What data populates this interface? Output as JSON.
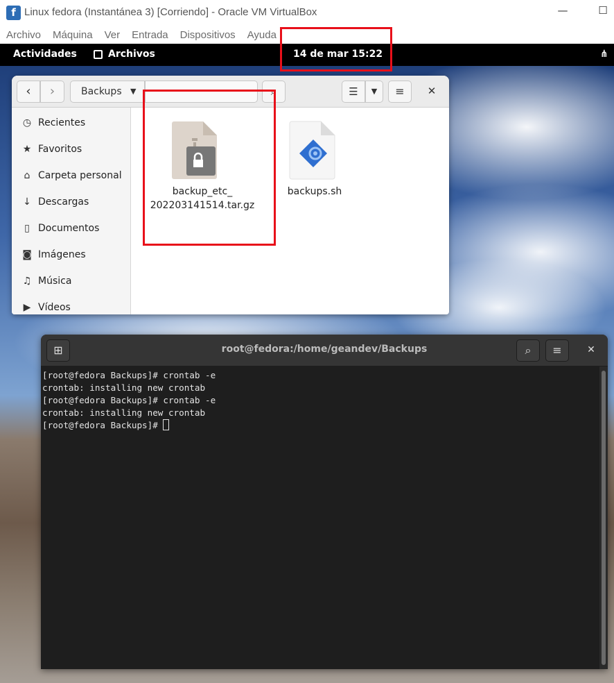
{
  "vbox": {
    "title": "Linux fedora (Instantánea 3) [Corriendo] - Oracle VM VirtualBox",
    "menu": [
      "Archivo",
      "Máquina",
      "Ver",
      "Entrada",
      "Dispositivos",
      "Ayuda"
    ]
  },
  "topbar": {
    "activities": "Actividades",
    "app_name": "Archivos",
    "clock": "14 de mar  15:22"
  },
  "files": {
    "path": "Backups",
    "sidebar": [
      {
        "label": "Recientes",
        "icon": "clock-icon"
      },
      {
        "label": "Favoritos",
        "icon": "star-icon"
      },
      {
        "label": "Carpeta personal",
        "icon": "home-icon"
      },
      {
        "label": "Descargas",
        "icon": "download-icon"
      },
      {
        "label": "Documentos",
        "icon": "document-icon"
      },
      {
        "label": "Imágenes",
        "icon": "camera-icon"
      },
      {
        "label": "Música",
        "icon": "music-icon"
      },
      {
        "label": "Vídeos",
        "icon": "video-icon"
      }
    ],
    "items": [
      {
        "name_line1": "backup_etc_",
        "name_line2": "202203141514.tar.gz",
        "icon": "archive-lock-icon"
      },
      {
        "name": "backups.sh",
        "icon": "script-icon"
      }
    ]
  },
  "terminal": {
    "title": "root@fedora:/home/geandev/Backups",
    "lines": [
      "[root@fedora Backups]# crontab -e",
      "crontab: installing new crontab",
      "[root@fedora Backups]# crontab -e",
      "crontab: installing new crontab",
      "[root@fedora Backups]# "
    ]
  }
}
